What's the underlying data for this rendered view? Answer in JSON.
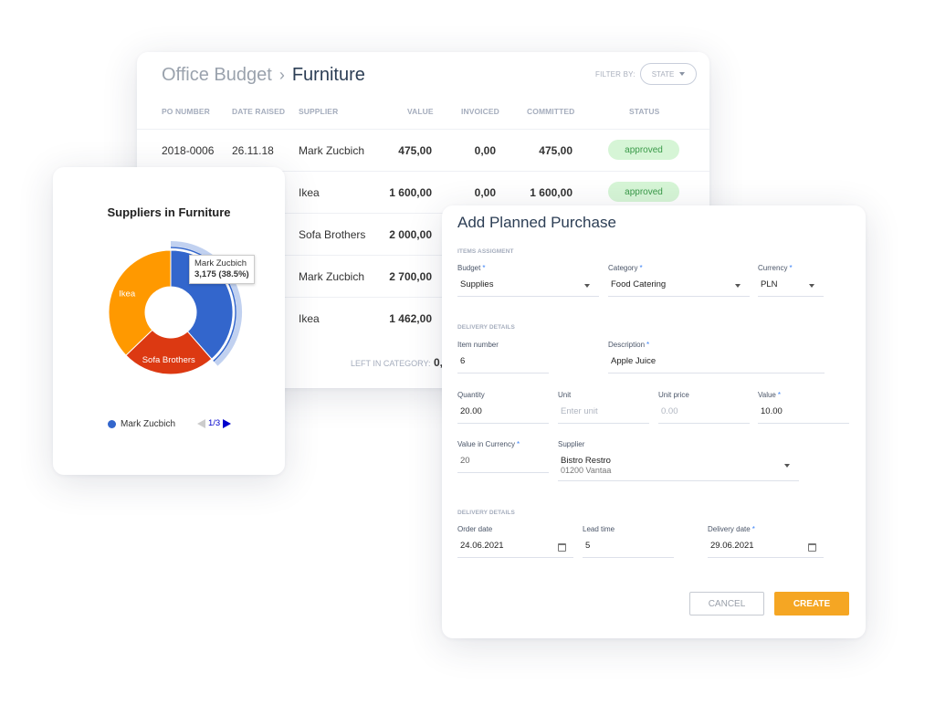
{
  "table": {
    "breadcrumb": {
      "parent": "Office Budget",
      "separator": "›",
      "current": "Furniture"
    },
    "filter": {
      "label": "FILTER BY:",
      "selected": "STATE"
    },
    "columns": [
      "PO NUMBER",
      "DATE RAISED",
      "SUPPLIER",
      "VALUE",
      "INVOICED",
      "COMMITTED",
      "STATUS"
    ],
    "rows": [
      {
        "po": "2018-0006",
        "date": "26.11.18",
        "supplier": "Mark Zucbich",
        "value": "475,00",
        "invoiced": "0,00",
        "committed": "475,00",
        "status": "approved"
      },
      {
        "po": "",
        "date": "",
        "supplier": "Ikea",
        "value": "1 600,00",
        "invoiced": "0,00",
        "committed": "1 600,00",
        "status": "approved"
      },
      {
        "po": "",
        "date": "",
        "supplier": "Sofa Brothers",
        "value": "2 000,00",
        "invoiced": "",
        "committed": "",
        "status": ""
      },
      {
        "po": "",
        "date": "",
        "supplier": "Mark Zucbich",
        "value": "2 700,00",
        "invoiced": "",
        "committed": "",
        "status": ""
      },
      {
        "po": "",
        "date": "",
        "supplier": "Ikea",
        "value": "1 462,00",
        "invoiced": "",
        "committed": "",
        "status": ""
      }
    ],
    "left_in_category": {
      "label": "LEFT IN CATEGORY:",
      "value": "0,"
    },
    "status_colors": {
      "approved_bg": "#d6f5d6",
      "approved_text": "#3a9a49"
    }
  },
  "chart_card": {
    "tooltip": {
      "name": "Mark Zucbich",
      "value": "3,175 (38.5%)"
    },
    "legend": {
      "label": "Mark Zucbich",
      "color": "#3366cc"
    },
    "pager": "1/3"
  },
  "chart_data": {
    "type": "pie",
    "title": "Suppliers in Furniture",
    "donut": true,
    "highlighted": "Mark Zucbich",
    "slices": [
      {
        "label": "Mark Zucbich",
        "value": 3175,
        "percent": 38.5,
        "color": "#3366cc",
        "show_label": false
      },
      {
        "label": "Sofa Brothers",
        "value": 2000,
        "percent": 24.3,
        "color": "#dc3912",
        "show_label": true
      },
      {
        "label": "Ikea",
        "value": 3062,
        "percent": 37.2,
        "color": "#ff9900",
        "show_label": true
      }
    ],
    "legend_position": "bottom"
  },
  "form": {
    "title": "Add Planned Purchase",
    "sections": {
      "items": "ITEMS ASSIGMENT",
      "delivery1": "DELIVERY DETAILS",
      "delivery2": "DELIVERY DETAILS"
    },
    "fields": {
      "budget": {
        "label": "Budget",
        "required": "*",
        "value": "Supplies"
      },
      "category": {
        "label": "Category",
        "required": "*",
        "value": "Food Catering"
      },
      "currency": {
        "label": "Currency",
        "required": "*",
        "value": "PLN"
      },
      "item_number": {
        "label": "Item number",
        "value": "6"
      },
      "description": {
        "label": "Description",
        "required": "*",
        "value": "Apple Juice"
      },
      "quantity": {
        "label": "Quantity",
        "value": "20.00"
      },
      "unit": {
        "label": "Unit",
        "placeholder": "Enter unit"
      },
      "unit_price": {
        "label": "Unit price",
        "placeholder": "0.00"
      },
      "value": {
        "label": "Value",
        "required": "*",
        "value": "10.00"
      },
      "value_in_currency": {
        "label": "Value in Currency",
        "required": "*",
        "value": "20"
      },
      "supplier": {
        "label": "Supplier",
        "name": "Bistro Restro",
        "address": "01200 Vantaa"
      },
      "order_date": {
        "label": "Order date",
        "value": "24.06.2021"
      },
      "lead_time": {
        "label": "Lead time",
        "value": "5"
      },
      "delivery_date": {
        "label": "Delivery date",
        "required": "*",
        "value": "29.06.2021"
      }
    },
    "buttons": {
      "cancel": "CANCEL",
      "create": "CREATE"
    },
    "accent": "#f5a623"
  }
}
